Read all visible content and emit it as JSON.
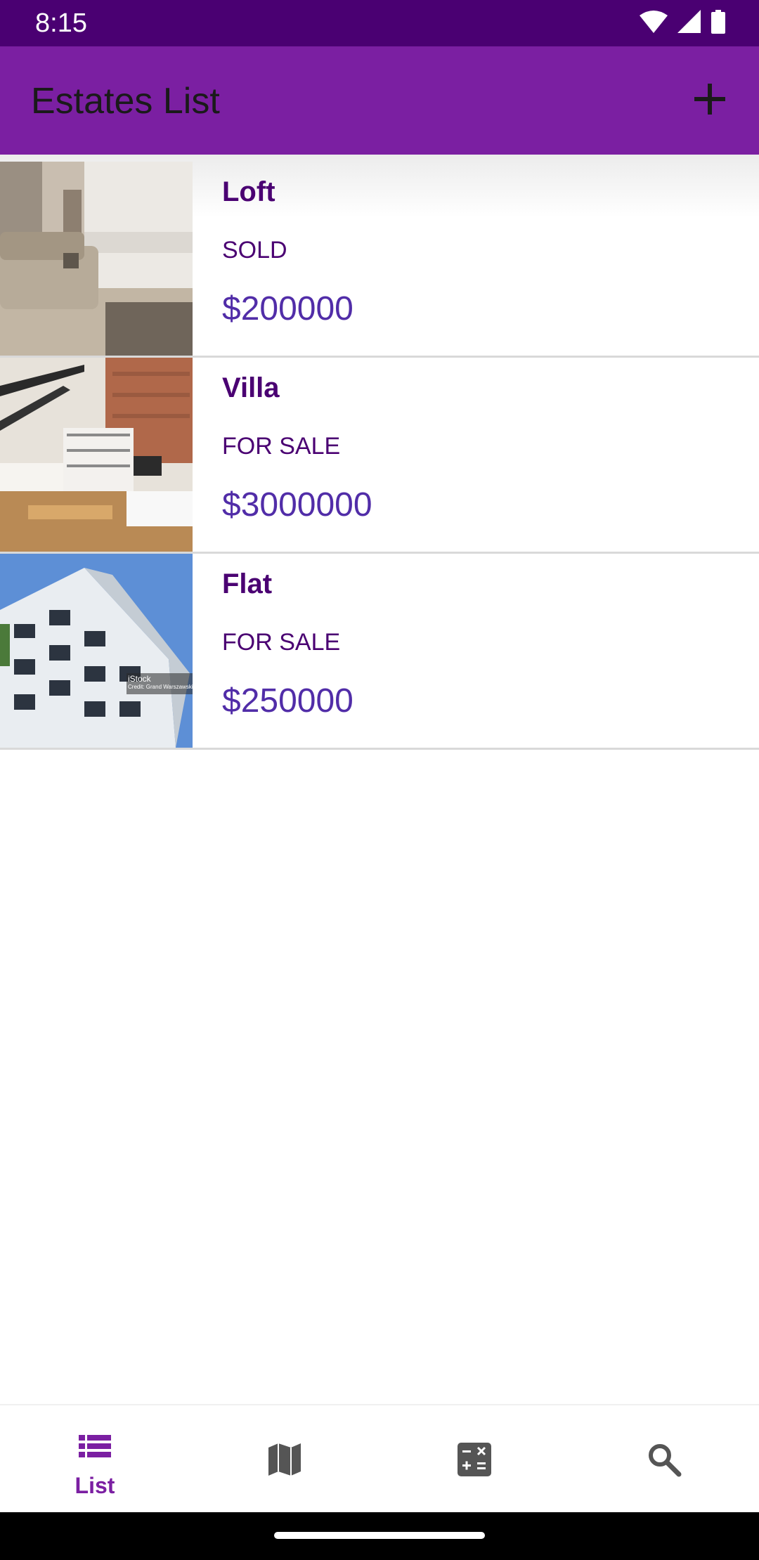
{
  "status_bar": {
    "time": "8:15"
  },
  "app_bar": {
    "title": "Estates List",
    "add_icon": "plus-icon"
  },
  "estates": [
    {
      "name": "Loft",
      "status": "SOLD",
      "price": "$200000"
    },
    {
      "name": "Villa",
      "status": "FOR SALE",
      "price": "$3000000"
    },
    {
      "name": "Flat",
      "status": "FOR SALE",
      "price": "$250000"
    }
  ],
  "photo_watermark": {
    "brand": "iStock",
    "credit": "Credit: Grand Warszawski"
  },
  "bottom_nav": {
    "tabs": [
      {
        "label": "List",
        "icon": "list-icon",
        "selected": true
      },
      {
        "label": "",
        "icon": "map-icon",
        "selected": false
      },
      {
        "label": "",
        "icon": "calculator-icon",
        "selected": false
      },
      {
        "label": "",
        "icon": "search-icon",
        "selected": false
      }
    ]
  },
  "colors": {
    "status_bar": "#4a0072",
    "app_bar": "#7b1fa2",
    "name_text": "#4a0072",
    "price_text": "#512da8",
    "nav_selected": "#7b1fa2",
    "nav_unselected": "#555555"
  }
}
